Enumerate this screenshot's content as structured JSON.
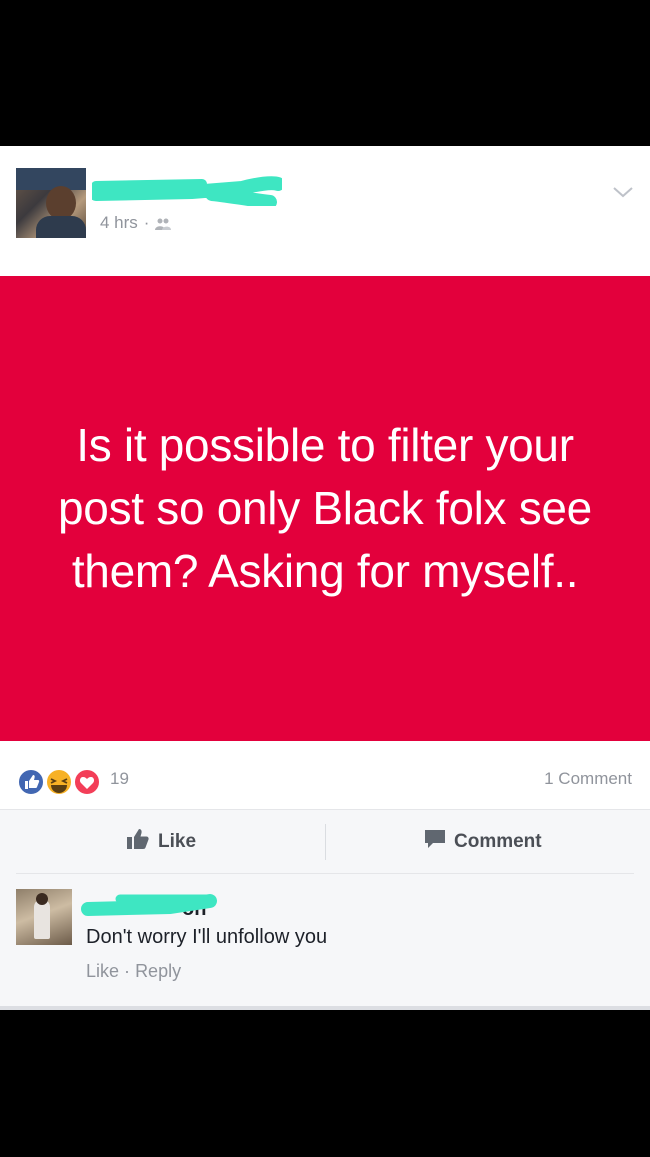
{
  "post": {
    "author_name": "",
    "timestamp": "4 hrs",
    "separator": "·",
    "privacy_icon": "friends-icon",
    "menu_icon": "chevron-down-icon",
    "status_text": "Is it possible to filter your post so only Black folx see them? Asking for myself..",
    "status_background": "#e3003c"
  },
  "reactions": {
    "icons": [
      "like-icon",
      "haha-icon",
      "love-icon"
    ],
    "count": "19",
    "comments_count": "1 Comment"
  },
  "actions": {
    "like_label": "Like",
    "comment_label": "Comment"
  },
  "comment": {
    "author_visible_fragment": "on",
    "text": "Don't worry I'll unfollow you",
    "like_label": "Like",
    "separator": "·",
    "reply_label": "Reply"
  },
  "colors": {
    "redaction": "#3ee6c2",
    "meta_text": "#90949c",
    "action_text": "#4b4f56",
    "like_blue": "#4267b2",
    "love_red": "#f33e58",
    "haha_yellow": "#f7b125"
  }
}
